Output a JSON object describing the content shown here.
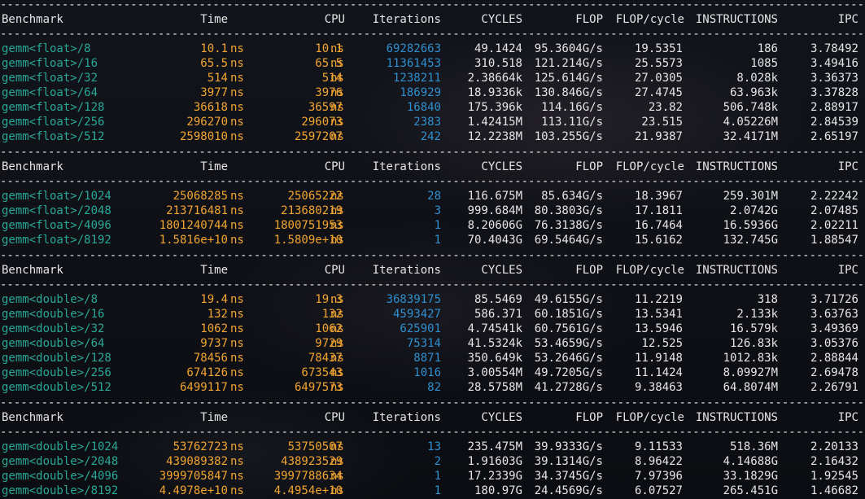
{
  "headers": {
    "benchmark": "Benchmark",
    "time": "Time",
    "cpu": "CPU",
    "iterations": "Iterations",
    "cycles": "CYCLES",
    "flop": "FLOP",
    "flop_per_cycle": "FLOP/cycle",
    "instructions": "INSTRUCTIONS",
    "ipc": "IPC"
  },
  "time_unit": "ns",
  "separator": "----------------------------------------------------------------------------------------------------------------------------------",
  "sections": [
    {
      "rows": [
        {
          "name": "gemm<float>/8",
          "time": "10.1",
          "cpu": "10.1",
          "iterations": "69282663",
          "cycles": "49.1424",
          "flop": "95.3604G/s",
          "flop_per_cycle": "19.5351",
          "instructions": "186",
          "ipc": "3.78492"
        },
        {
          "name": "gemm<float>/16",
          "time": "65.5",
          "cpu": "65.5",
          "iterations": "11361453",
          "cycles": "310.518",
          "flop": "121.214G/s",
          "flop_per_cycle": "25.5573",
          "instructions": "1085",
          "ipc": "3.49416"
        },
        {
          "name": "gemm<float>/32",
          "time": "514",
          "cpu": "514",
          "iterations": "1238211",
          "cycles": "2.38664k",
          "flop": "125.614G/s",
          "flop_per_cycle": "27.0305",
          "instructions": "8.028k",
          "ipc": "3.36373"
        },
        {
          "name": "gemm<float>/64",
          "time": "3977",
          "cpu": "3976",
          "iterations": "186929",
          "cycles": "18.9336k",
          "flop": "130.846G/s",
          "flop_per_cycle": "27.4745",
          "instructions": "63.963k",
          "ipc": "3.37828"
        },
        {
          "name": "gemm<float>/128",
          "time": "36618",
          "cpu": "36597",
          "iterations": "16840",
          "cycles": "175.396k",
          "flop": "114.16G/s",
          "flop_per_cycle": "23.82",
          "instructions": "506.748k",
          "ipc": "2.88917"
        },
        {
          "name": "gemm<float>/256",
          "time": "296270",
          "cpu": "296073",
          "iterations": "2383",
          "cycles": "1.42415M",
          "flop": "113.11G/s",
          "flop_per_cycle": "23.515",
          "instructions": "4.05226M",
          "ipc": "2.84539"
        },
        {
          "name": "gemm<float>/512",
          "time": "2598010",
          "cpu": "2597207",
          "iterations": "242",
          "cycles": "12.2238M",
          "flop": "103.255G/s",
          "flop_per_cycle": "21.9387",
          "instructions": "32.4171M",
          "ipc": "2.65197"
        }
      ]
    },
    {
      "rows": [
        {
          "name": "gemm<float>/1024",
          "time": "25068285",
          "cpu": "25065222",
          "iterations": "28",
          "cycles": "116.675M",
          "flop": "85.634G/s",
          "flop_per_cycle": "18.3967",
          "instructions": "259.301M",
          "ipc": "2.22242"
        },
        {
          "name": "gemm<float>/2048",
          "time": "213716481",
          "cpu": "213680219",
          "iterations": "3",
          "cycles": "999.684M",
          "flop": "80.3803G/s",
          "flop_per_cycle": "17.1811",
          "instructions": "2.0742G",
          "ipc": "2.07485"
        },
        {
          "name": "gemm<float>/4096",
          "time": "1801240744",
          "cpu": "1800751953",
          "iterations": "1",
          "cycles": "8.20606G",
          "flop": "76.3138G/s",
          "flop_per_cycle": "16.7464",
          "instructions": "16.5936G",
          "ipc": "2.02211"
        },
        {
          "name": "gemm<float>/8192",
          "time": "1.5816e+10",
          "cpu": "1.5809e+10",
          "iterations": "1",
          "cycles": "70.4043G",
          "flop": "69.5464G/s",
          "flop_per_cycle": "15.6162",
          "instructions": "132.745G",
          "ipc": "1.88547"
        }
      ]
    },
    {
      "rows": [
        {
          "name": "gemm<double>/8",
          "time": "19.4",
          "cpu": "19.3",
          "iterations": "36839175",
          "cycles": "85.5469",
          "flop": "49.6155G/s",
          "flop_per_cycle": "11.2219",
          "instructions": "318",
          "ipc": "3.71726"
        },
        {
          "name": "gemm<double>/16",
          "time": "132",
          "cpu": "132",
          "iterations": "4593427",
          "cycles": "586.371",
          "flop": "60.1851G/s",
          "flop_per_cycle": "13.5341",
          "instructions": "2.133k",
          "ipc": "3.63763"
        },
        {
          "name": "gemm<double>/32",
          "time": "1062",
          "cpu": "1062",
          "iterations": "625901",
          "cycles": "4.74541k",
          "flop": "60.7561G/s",
          "flop_per_cycle": "13.5946",
          "instructions": "16.579k",
          "ipc": "3.49369"
        },
        {
          "name": "gemm<double>/64",
          "time": "9737",
          "cpu": "9729",
          "iterations": "75314",
          "cycles": "41.5324k",
          "flop": "53.4659G/s",
          "flop_per_cycle": "12.525",
          "instructions": "126.83k",
          "ipc": "3.05376"
        },
        {
          "name": "gemm<double>/128",
          "time": "78456",
          "cpu": "78437",
          "iterations": "8871",
          "cycles": "350.649k",
          "flop": "53.2646G/s",
          "flop_per_cycle": "11.9148",
          "instructions": "1012.83k",
          "ipc": "2.88844"
        },
        {
          "name": "gemm<double>/256",
          "time": "674126",
          "cpu": "673543",
          "iterations": "1016",
          "cycles": "3.00554M",
          "flop": "49.7205G/s",
          "flop_per_cycle": "11.1424",
          "instructions": "8.09927M",
          "ipc": "2.69478"
        },
        {
          "name": "gemm<double>/512",
          "time": "6499117",
          "cpu": "6497573",
          "iterations": "82",
          "cycles": "28.5758M",
          "flop": "41.2728G/s",
          "flop_per_cycle": "9.38463",
          "instructions": "64.8074M",
          "ipc": "2.26791"
        }
      ]
    },
    {
      "rows": [
        {
          "name": "gemm<double>/1024",
          "time": "53762723",
          "cpu": "53750507",
          "iterations": "13",
          "cycles": "235.475M",
          "flop": "39.9333G/s",
          "flop_per_cycle": "9.11533",
          "instructions": "518.36M",
          "ipc": "2.20133"
        },
        {
          "name": "gemm<double>/2048",
          "time": "439089382",
          "cpu": "438923529",
          "iterations": "2",
          "cycles": "1.91603G",
          "flop": "39.1314G/s",
          "flop_per_cycle": "8.96422",
          "instructions": "4.14688G",
          "ipc": "2.16432"
        },
        {
          "name": "gemm<double>/4096",
          "time": "3999705847",
          "cpu": "3997788634",
          "iterations": "1",
          "cycles": "17.2339G",
          "flop": "34.3745G/s",
          "flop_per_cycle": "7.97396",
          "instructions": "33.1829G",
          "ipc": "1.92545"
        },
        {
          "name": "gemm<double>/8192",
          "time": "4.4978e+10",
          "cpu": "4.4954e+10",
          "iterations": "1",
          "cycles": "180.97G",
          "flop": "24.4569G/s",
          "flop_per_cycle": "6.07527",
          "instructions": "265.451G",
          "ipc": "1.46682"
        }
      ]
    }
  ]
}
